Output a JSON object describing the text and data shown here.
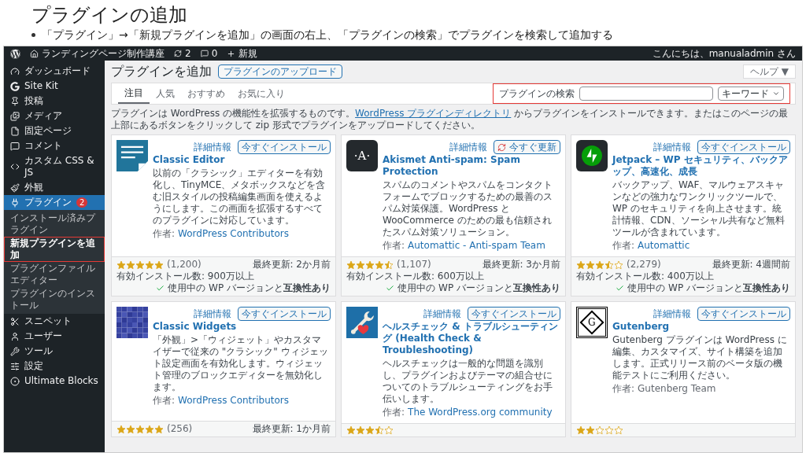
{
  "slide": {
    "title": "プラグインの追加",
    "bullets": [
      "「プラグイン」→「新規プラグインを追加」の画面の右上、「プラグインの検索」でプラグインを検索して追加する"
    ]
  },
  "admin_bar": {
    "site": "ランディングページ制作講座",
    "updates": "2",
    "comments": "0",
    "new": "新規",
    "greeting": "こんにちは、manualadmin さん"
  },
  "sidebar": {
    "items": [
      {
        "label": "ダッシュボード",
        "selected": false
      },
      {
        "label": "Site Kit",
        "selected": false
      },
      {
        "label": "投稿",
        "selected": false
      },
      {
        "label": "メディア",
        "selected": false
      },
      {
        "label": "固定ページ",
        "selected": false
      },
      {
        "label": "コメント",
        "selected": false
      },
      {
        "label": "カスタム CSS & JS",
        "selected": false
      },
      {
        "label": "外観",
        "selected": false
      },
      {
        "label": "プラグイン",
        "selected": true,
        "badge": "2",
        "children": [
          {
            "label": "インストール済みプラグイン",
            "selected": false
          },
          {
            "label": "新規プラグインを追加",
            "selected": true
          },
          {
            "label": "プラグインファイルエディター",
            "selected": false
          },
          {
            "label": "プラグインのインストール",
            "selected": false
          }
        ]
      },
      {
        "label": "スニペット",
        "selected": false
      },
      {
        "label": "ユーザー",
        "selected": false
      },
      {
        "label": "ツール",
        "selected": false
      },
      {
        "label": "設定",
        "selected": false
      },
      {
        "label": "Ultimate Blocks",
        "selected": false
      }
    ]
  },
  "page": {
    "title": "プラグインを追加",
    "upload_button": "プラグインのアップロード",
    "help": "ヘルプ ▼",
    "tabs": [
      {
        "label": "注目",
        "selected": true
      },
      {
        "label": "人気",
        "selected": false
      },
      {
        "label": "おすすめ",
        "selected": false
      },
      {
        "label": "お気に入り",
        "selected": false
      }
    ],
    "search": {
      "label": "プラグインの検索",
      "type": "キーワード"
    },
    "intro": [
      "プラグインは WordPress の機能性を拡張するものです。",
      "WordPress プラグインディレクトリ",
      "からプラグインをインストールできます。またはこのページの最上部にあるボタンをクリックして zip 形式でプラグインをアップロードしてください。"
    ]
  },
  "plugins": [
    {
      "name": "Classic Editor",
      "kind": "document",
      "button": {
        "kind": "install",
        "label": "今すぐインストール"
      },
      "details": "詳細情報",
      "description": "以前の「クラシック」エディターを有効化し、TinyMCE、メタボックスなどを含む旧スタイルの投稿編集画面を使えるようにします。この画面を拡張するすべてのプラグインに対応しています。",
      "author_label": "作者:",
      "author": "WordPress Contributors",
      "stars": 5,
      "ratings": "(1,200)",
      "installs": "有効インストール数: 900万以上",
      "updated": "最終更新: 2か月前",
      "compat": "使用中の WP バージョンと**互換性あり**"
    },
    {
      "name": "Akismet Anti-spam: Spam Protection",
      "kind": "letter",
      "logo_text": "·A·",
      "button": {
        "kind": "update",
        "label": "今すぐ更新"
      },
      "details": "詳細情報",
      "description": "スパムのコメントやスパムをコンタクトフォームでブロックするための最善のスパム対策保護。WordPress と WooCommerce のための最も信頼されたスパム対策ソリューション。",
      "author_label": "作者:",
      "author": "Automattic - Anti-spam Team",
      "stars": 4.5,
      "ratings": "(1,107)",
      "installs": "有効インストール数: 600万以上",
      "updated": "最終更新: 3か月前",
      "compat": "使用中の WP バージョンと**互換性あり**"
    },
    {
      "name": "Jetpack – WP セキュリティ、バックアップ、高速化、成長",
      "kind": "bolt",
      "button": {
        "kind": "install",
        "label": "今すぐインストール"
      },
      "details": "詳細情報",
      "description": "バックアップ、WAF、マルウェアスキャンなどの強力なワンクリックツールで、WP のセキュリティを向上させます。統計情報、CDN、ソーシャル共有など無料ツールが含まれています。",
      "author_label": "作者:",
      "author": "Automattic",
      "stars": 3.5,
      "ratings": "(2,279)",
      "installs": "有効インストール数: 400万以上",
      "updated": "最終更新: 4週間前",
      "compat": "使用中の WP バージョンと**互換性あり**"
    },
    {
      "name": "Classic Widgets",
      "kind": "mosaic",
      "button": {
        "kind": "install",
        "label": "今すぐインストール"
      },
      "details": "詳細情報",
      "description": "「外観」>「ウィジェット」やカスタマイザーで従来の \"クラシック\" ウィジェット設定画面を有効化します。ウィジェット管理のブロックエディターを無効化します。",
      "author_label": "作者:",
      "author": "WordPress Contributors",
      "stars": 5,
      "ratings": "(256)",
      "updated": "最終更新: 1か月前"
    },
    {
      "name": "ヘルスチェック & トラブルシューティング (Health Check & Troubleshooting)",
      "kind": "wrench",
      "button": {
        "kind": "install",
        "label": "今すぐインストール"
      },
      "details": "詳細情報",
      "description": "ヘルスチェックは一般的な問題を識別し、プラグインおよびテーマの組合せについてのトラブルシューティングをお手伝いします。",
      "author_label": "作者:",
      "author": "The WordPress.org community",
      "stars": 3.5
    },
    {
      "name": "Gutenberg",
      "kind": "ornament",
      "logo_text": "G",
      "button": {
        "kind": "install",
        "label": "今すぐインストール"
      },
      "details": "詳細情報",
      "description": "Gutenberg プラグインは WordPress に編集、カスタマイズ、サイト構築を追加します。正式リリース前のベータ版の機能テストにご利用ください。",
      "author_label": "作者:",
      "author": "Gutenberg Team",
      "author_plain": true,
      "stars": 2
    }
  ]
}
